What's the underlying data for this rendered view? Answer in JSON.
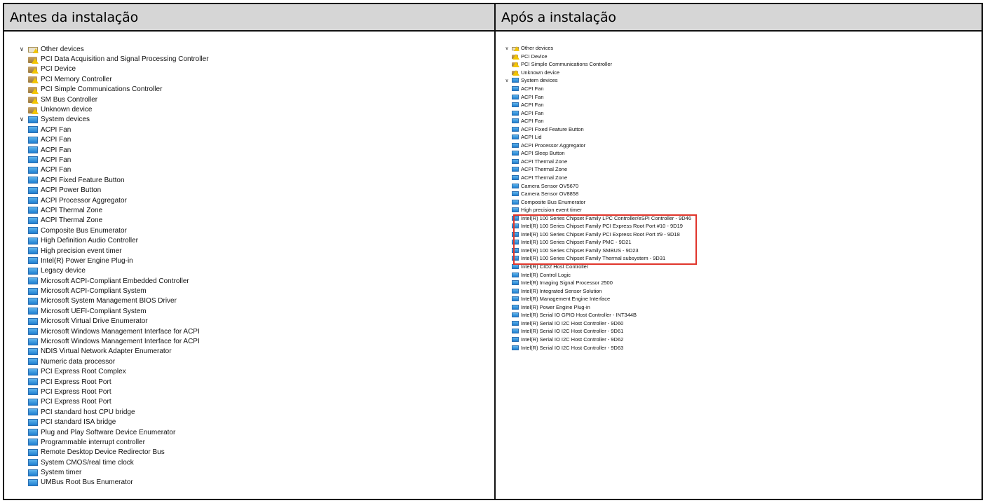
{
  "left": {
    "title": "Antes da instalação",
    "groups": [
      {
        "label": "Other devices",
        "items": [
          "PCI Data Acquisition and Signal Processing Controller",
          "PCI Device",
          "PCI Memory Controller",
          "PCI Simple Communications Controller",
          "SM Bus Controller",
          "Unknown device"
        ]
      },
      {
        "label": "System devices",
        "items": [
          "ACPI Fan",
          "ACPI Fan",
          "ACPI Fan",
          "ACPI Fan",
          "ACPI Fan",
          "ACPI Fixed Feature Button",
          "ACPI Power Button",
          "ACPI Processor Aggregator",
          "ACPI Thermal Zone",
          "ACPI Thermal Zone",
          "Composite Bus Enumerator",
          "High Definition Audio Controller",
          "High precision event timer",
          "Intel(R) Power Engine Plug-in",
          "Legacy device",
          "Microsoft ACPI-Compliant Embedded Controller",
          "Microsoft ACPI-Compliant System",
          "Microsoft System Management BIOS Driver",
          "Microsoft UEFI-Compliant System",
          "Microsoft Virtual Drive Enumerator",
          "Microsoft Windows Management Interface for ACPI",
          "Microsoft Windows Management Interface for ACPI",
          "NDIS Virtual Network Adapter Enumerator",
          "Numeric data processor",
          "PCI Express Root Complex",
          "PCI Express Root Port",
          "PCI Express Root Port",
          "PCI Express Root Port",
          "PCI standard host CPU bridge",
          "PCI standard ISA bridge",
          "Plug and Play Software Device Enumerator",
          "Programmable interrupt controller",
          "Remote Desktop Device Redirector Bus",
          "System CMOS/real time clock",
          "System timer",
          "UMBus Root Bus Enumerator"
        ]
      }
    ]
  },
  "right": {
    "title": "Após a instalação",
    "groups": [
      {
        "label": "Other devices",
        "items": [
          "PCI Device",
          "PCI Simple Communications Controller",
          "Unknown device"
        ]
      },
      {
        "label": "System devices",
        "items": [
          "ACPI Fan",
          "ACPI Fan",
          "ACPI Fan",
          "ACPI Fan",
          "ACPI Fan",
          "ACPI Fixed Feature Button",
          "ACPI Lid",
          "ACPI Processor Aggregator",
          "ACPI Sleep Button",
          "ACPI Thermal Zone",
          "ACPI Thermal Zone",
          "ACPI Thermal Zone",
          "Camera Sensor OV5670",
          "Camera Sensor OV8858",
          "Composite Bus Enumerator",
          "High precision event timer",
          "Intel(R) 100 Series Chipset Family LPC Controller/eSPI Controller - 9D46",
          "Intel(R) 100 Series Chipset Family PCI Express Root Port #10 - 9D19",
          "Intel(R) 100 Series Chipset Family PCI Express Root Port #9 - 9D18",
          "Intel(R) 100 Series Chipset Family PMC - 9D21",
          "Intel(R) 100 Series Chipset Family SMBUS - 9D23",
          "Intel(R) 100 Series Chipset Family Thermal subsystem - 9D31",
          "Intel(R) CIO2 Host Controller",
          "Intel(R) Control Logic",
          "Intel(R) Imaging Signal Processor 2500",
          "Intel(R) Integrated Sensor Solution",
          "Intel(R) Management Engine Interface",
          "Intel(R) Power Engine Plug-in",
          "Intel(R) Serial IO GPIO Host Controller - INT344B",
          "Intel(R) Serial IO I2C Host Controller - 9D60",
          "Intel(R) Serial IO I2C Host Controller - 9D61",
          "Intel(R) Serial IO I2C Host Controller - 9D62",
          "Intel(R) Serial IO I2C Host Controller - 9D63"
        ]
      }
    ]
  },
  "colors": {
    "highlight": "#e0352b",
    "header_bg": "#d6d6d6"
  },
  "icons": {
    "expand": "chevron-down-icon",
    "group_other": "unknown-devices-folder-icon",
    "group_system": "system-devices-icon",
    "warning_item": "warning-device-icon",
    "system_item": "monitor-device-icon"
  }
}
